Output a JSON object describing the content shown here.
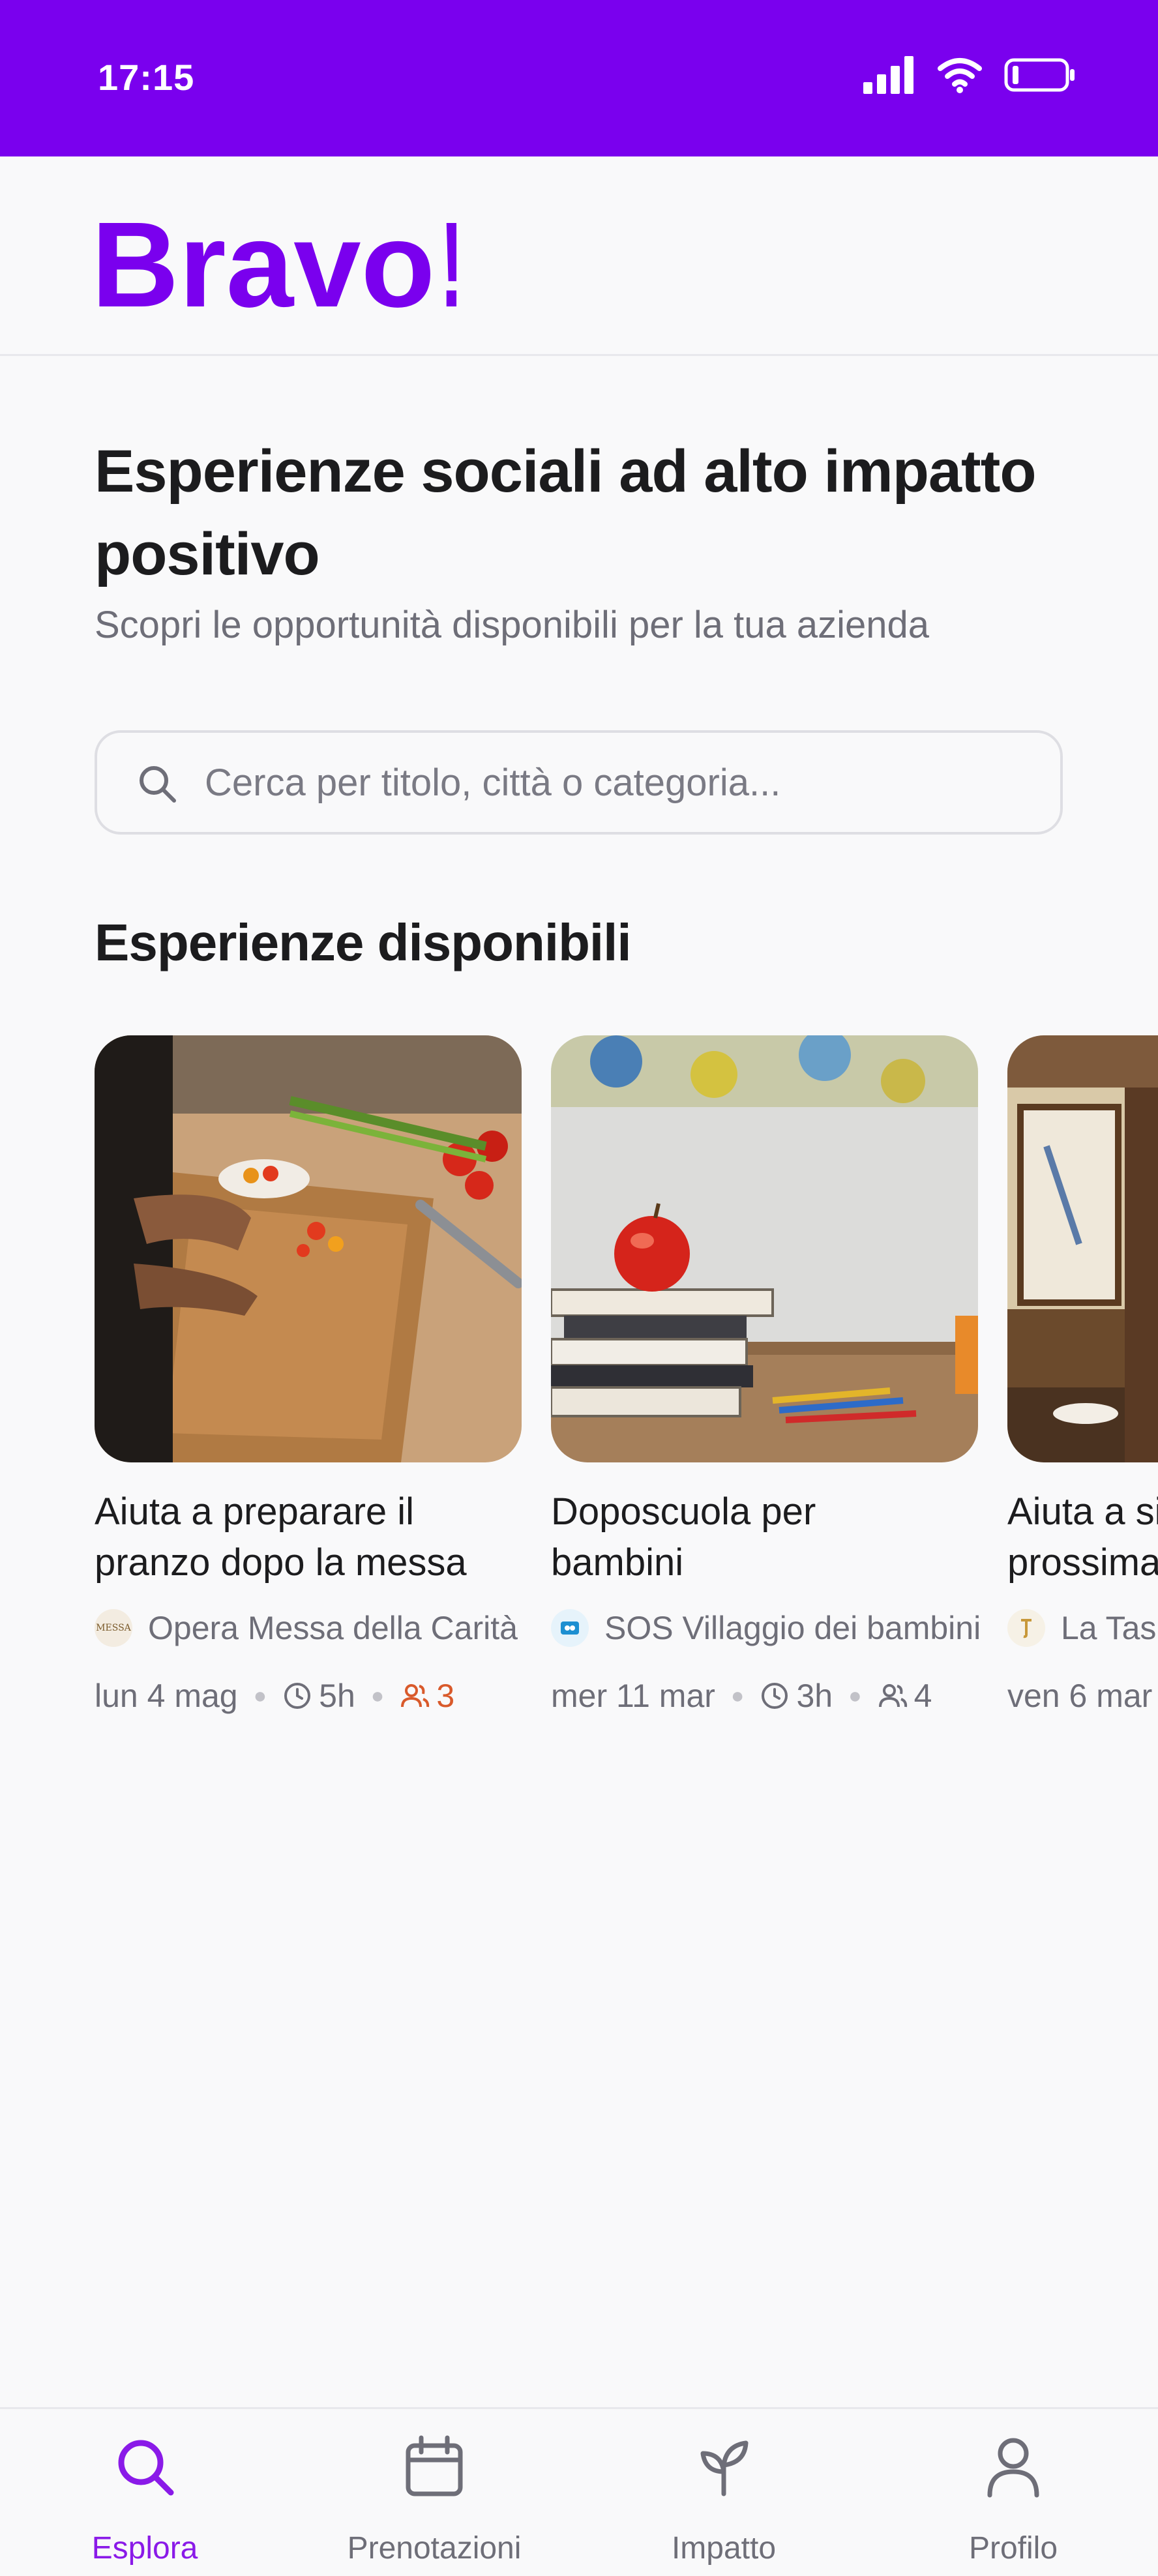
{
  "status_bar": {
    "time": "17:15"
  },
  "header": {
    "logo_text": "Bravo!"
  },
  "hero": {
    "title": "Esperienze sociali ad alto impatto positivo",
    "subtitle": "Scopri le opportunità disponibili per la tua azienda"
  },
  "search": {
    "placeholder": "Cerca per titolo, città o categoria..."
  },
  "section": {
    "title": "Esperienze disponibili"
  },
  "experiences": [
    {
      "title": "Aiuta a preparare il\npranzo dopo la messa",
      "org": "Opera Messa della Carità",
      "org_logo_text": "MESSA",
      "date": "lun 4 mag",
      "duration": "5h",
      "seats": "3",
      "seats_low": true,
      "image": "cutting-board-vegetables"
    },
    {
      "title": "Doposcuola per\nbambini",
      "org": "SOS Villaggio dei bambini",
      "date": "mer 11 mar",
      "duration": "3h",
      "seats": "4",
      "seats_low": false,
      "image": "books-apple-pencils"
    },
    {
      "title": "Aiuta a si\nprossima",
      "org": "La Task",
      "date": "ven 6 mar",
      "image": "living-room"
    }
  ],
  "tabbar": {
    "tabs": [
      {
        "label": "Esplora",
        "icon": "search-icon",
        "active": true
      },
      {
        "label": "Prenotazioni",
        "icon": "calendar-icon",
        "active": false
      },
      {
        "label": "Impatto",
        "icon": "sprout-icon",
        "active": false
      },
      {
        "label": "Profilo",
        "icon": "user-icon",
        "active": false
      }
    ]
  },
  "colors": {
    "brand": "#7a00ee",
    "active_tab": "#8a1ae8",
    "warning": "#d95a2b",
    "muted_text": "#6e6e78"
  }
}
